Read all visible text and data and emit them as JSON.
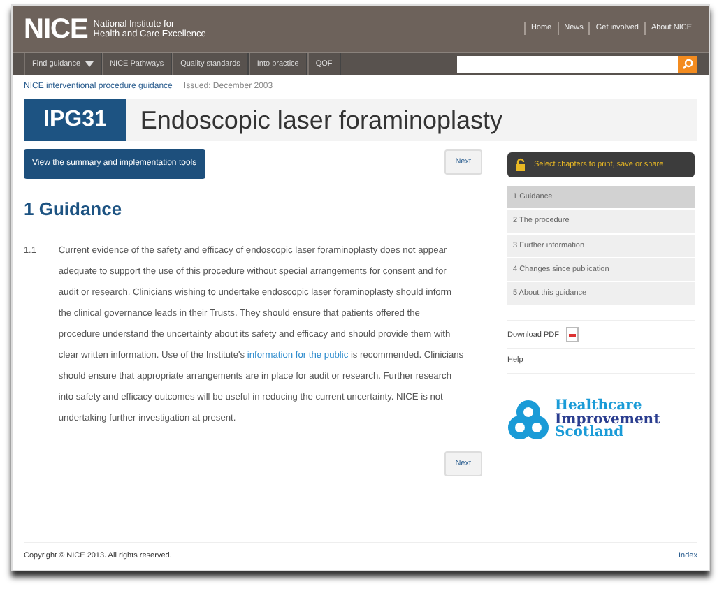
{
  "header": {
    "logo": "NICE",
    "org_name": [
      "National Institute for",
      "Health and Care Excellence"
    ],
    "links": [
      "Home",
      "News",
      "Get involved",
      "About NICE"
    ]
  },
  "nav": {
    "items": [
      {
        "label": "Find guidance",
        "dropdown": true
      },
      {
        "label": "NICE Pathways",
        "dropdown": false
      },
      {
        "label": "Quality standards",
        "dropdown": false
      },
      {
        "label": "Into practice",
        "dropdown": false
      },
      {
        "label": "QOF",
        "dropdown": false
      }
    ]
  },
  "breadcrumb": {
    "link": "NICE interventional procedure guidance",
    "issued": "Issued: December 2003"
  },
  "title": {
    "code": "IPG31",
    "text": "Endoscopic laser foraminoplasty"
  },
  "summary_button": "View the summary and implementation tools",
  "next_buttons": [
    "Next",
    "Next"
  ],
  "guidance": {
    "heading": "1 Guidance",
    "number": "1.1",
    "text_before": "Current evidence of the safety and efficacy of endoscopic laser foraminoplasty does not appear adequate to support the use of this procedure without special arrangements for consent and for audit or research. Clinicians wishing to undertake endoscopic laser foraminoplasty should inform the clinical governance leads in their Trusts. They should ensure that patients offered the procedure understand the uncertainty about its safety and efficacy and should provide them with clear written information. Use of the Institute's",
    "link": "information for the public",
    "text_after": "is recommended. Clinicians should ensure that appropriate arrangements are in place for audit or research. Further research into safety and efficacy outcomes will be useful in reducing the current uncertainty. NICE is not undertaking further investigation at present."
  },
  "sidebar": {
    "select_button": "Select chapters to print, save or share",
    "chapters": [
      {
        "label": "1 Guidance",
        "selected": true
      },
      {
        "label": "2 The procedure",
        "selected": false
      },
      {
        "label": "3 Further information",
        "selected": false
      },
      {
        "label": "4 Changes since publication",
        "selected": false
      },
      {
        "label": "5 About this guidance",
        "selected": false
      }
    ],
    "download": "Download PDF",
    "help": "Help",
    "partner_logo": [
      "Healthcare",
      "Improvement",
      "Scotland"
    ]
  },
  "footer": {
    "copyright": "Copyright © NICE 2013. All rights reserved.",
    "index": "Index"
  }
}
